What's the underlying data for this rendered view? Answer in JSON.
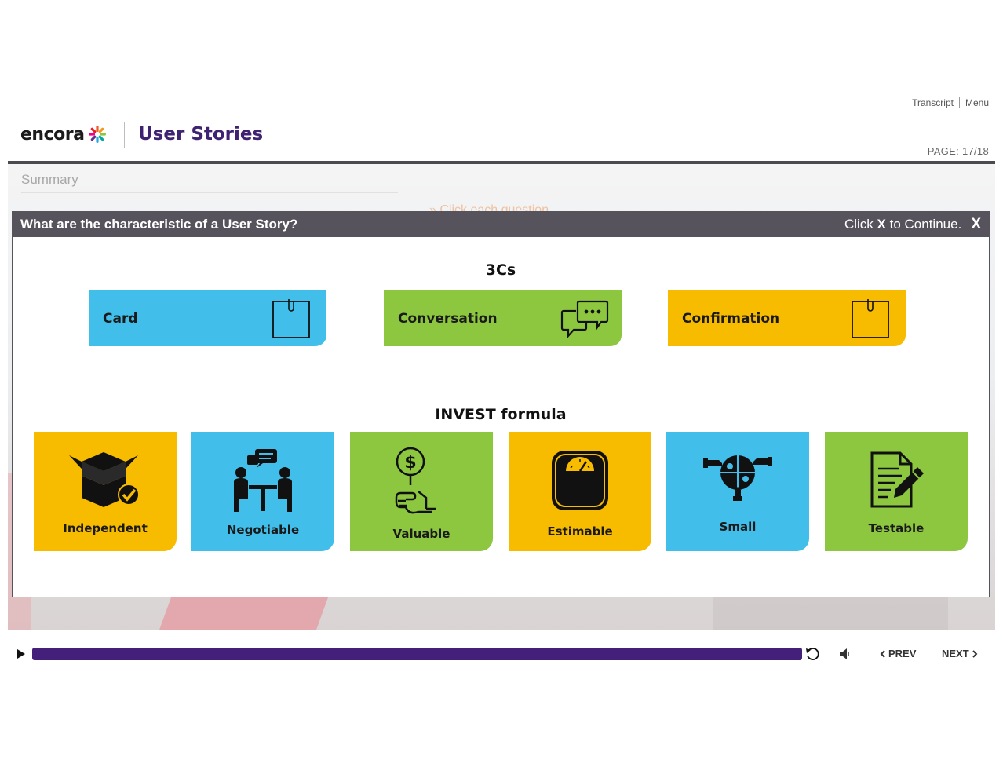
{
  "top_links": {
    "transcript": "Transcript",
    "menu": "Menu"
  },
  "header": {
    "logo_text": "encora",
    "course_title": "User Stories",
    "page_indicator": "PAGE: 17/18"
  },
  "stage": {
    "section_label": "Summary",
    "hint": "» Click each question"
  },
  "modal": {
    "title": "What are the characteristic of a User Story?",
    "continue_prefix": "Click ",
    "continue_key": "X",
    "continue_suffix": " to Continue.",
    "close_label": "X",
    "three_cs": {
      "heading": "3Cs",
      "items": [
        {
          "label": "Card",
          "color": "#41bfea",
          "icon": "sticky-note-icon"
        },
        {
          "label": "Conversation",
          "color": "#8dc63f",
          "icon": "chat-bubbles-icon"
        },
        {
          "label": "Confirmation",
          "color": "#f7bb00",
          "icon": "sticky-note-icon"
        }
      ]
    },
    "invest": {
      "heading": "INVEST formula",
      "items": [
        {
          "label": "Independent",
          "color": "#f7bb00",
          "icon": "box-check-icon"
        },
        {
          "label": "Negotiable",
          "color": "#41bfea",
          "icon": "meeting-table-icon"
        },
        {
          "label": "Valuable",
          "color": "#8dc63f",
          "icon": "hand-dollar-icon"
        },
        {
          "label": "Estimable",
          "color": "#f7bb00",
          "icon": "scale-icon"
        },
        {
          "label": "Small",
          "color": "#41bfea",
          "icon": "puzzle-hands-icon"
        },
        {
          "label": "Testable",
          "color": "#8dc63f",
          "icon": "document-pencil-icon"
        }
      ]
    }
  },
  "player": {
    "progress_fraction": 1.0,
    "progress_color": "#44207a",
    "prev_label": "PREV",
    "next_label": "NEXT",
    "icons": [
      "play-icon",
      "replay-icon",
      "volume-icon"
    ]
  }
}
